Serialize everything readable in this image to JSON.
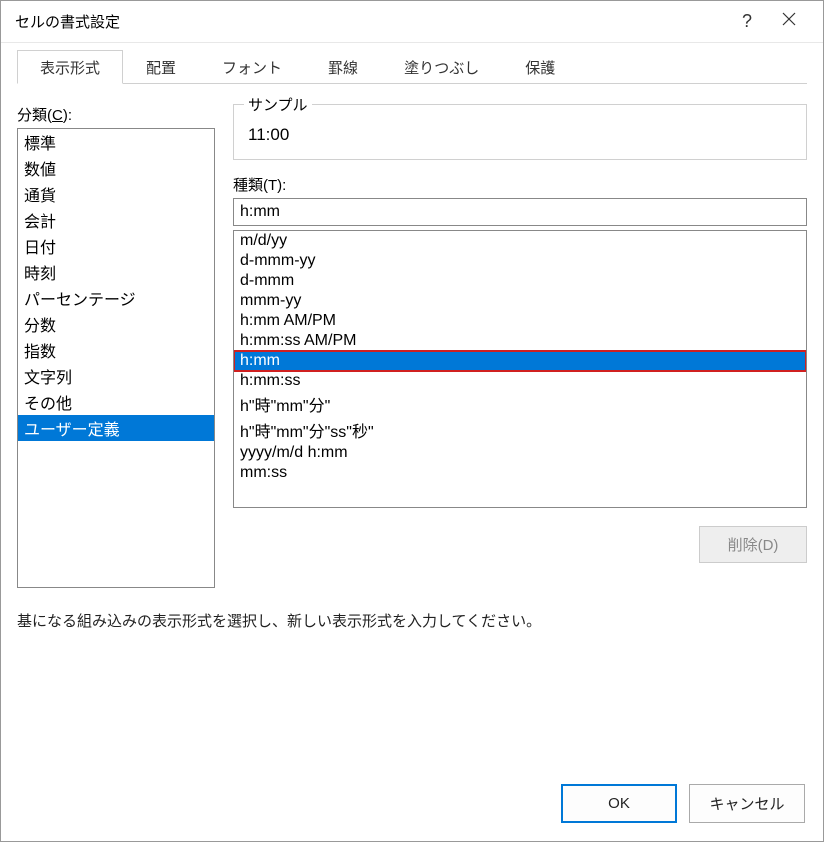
{
  "title": "セルの書式設定",
  "tabs": [
    {
      "label": "表示形式",
      "active": true
    },
    {
      "label": "配置"
    },
    {
      "label": "フォント"
    },
    {
      "label": "罫線"
    },
    {
      "label": "塗りつぶし"
    },
    {
      "label": "保護"
    }
  ],
  "category": {
    "label_prefix": "分類(",
    "label_key": "C",
    "label_suffix": "):",
    "items": [
      {
        "label": "標準"
      },
      {
        "label": "数値"
      },
      {
        "label": "通貨"
      },
      {
        "label": "会計"
      },
      {
        "label": "日付"
      },
      {
        "label": "時刻"
      },
      {
        "label": "パーセンテージ"
      },
      {
        "label": "分数"
      },
      {
        "label": "指数"
      },
      {
        "label": "文字列"
      },
      {
        "label": "その他"
      },
      {
        "label": "ユーザー定義",
        "selected": true
      }
    ]
  },
  "sample": {
    "legend": "サンプル",
    "value": "11:00"
  },
  "type": {
    "label_prefix": "種類(",
    "label_key": "T",
    "label_suffix": "):",
    "value": "h:mm",
    "items": [
      {
        "label": "m/d/yy"
      },
      {
        "label": "d-mmm-yy"
      },
      {
        "label": "d-mmm"
      },
      {
        "label": "mmm-yy"
      },
      {
        "label": "h:mm AM/PM"
      },
      {
        "label": "h:mm:ss AM/PM"
      },
      {
        "label": "h:mm",
        "selected": true,
        "highlighted": true
      },
      {
        "label": "h:mm:ss"
      },
      {
        "label": "h\"時\"mm\"分\""
      },
      {
        "label": "h\"時\"mm\"分\"ss\"秒\""
      },
      {
        "label": "yyyy/m/d h:mm"
      },
      {
        "label": "mm:ss"
      }
    ]
  },
  "delete_label": "削除(D)",
  "hint": "基になる組み込みの表示形式を選択し、新しい表示形式を入力してください。",
  "ok_label": "OK",
  "cancel_label": "キャンセル"
}
